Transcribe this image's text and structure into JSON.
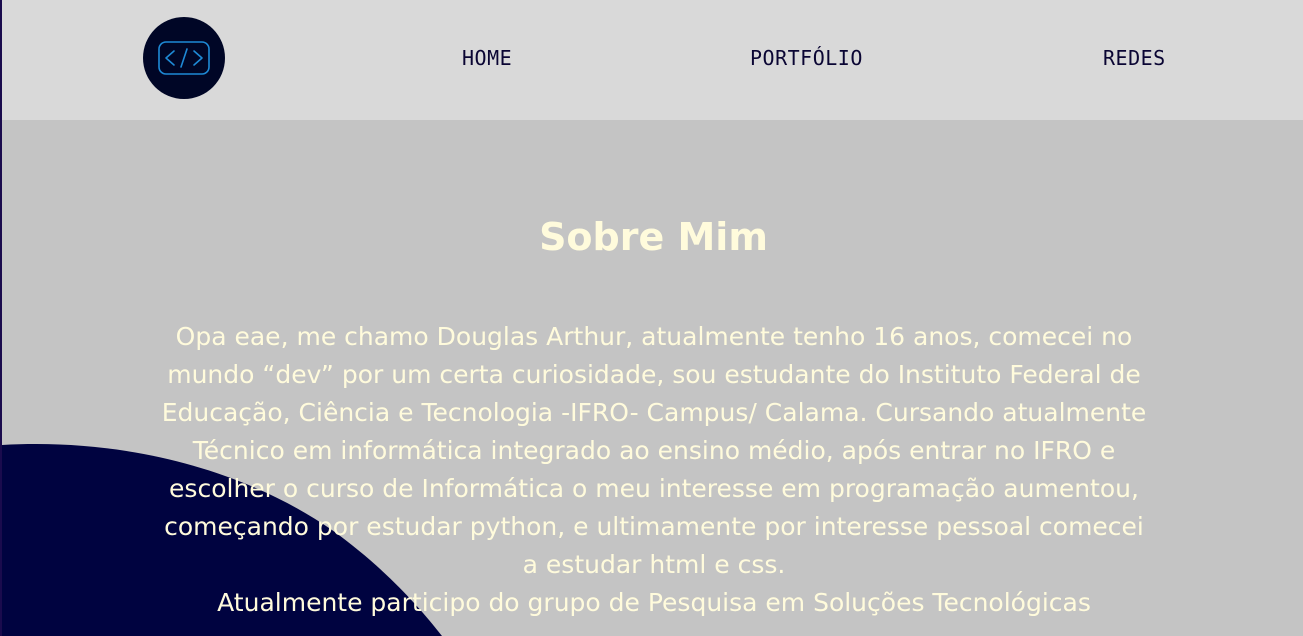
{
  "navbar": {
    "logo_icon": "code-brackets-icon",
    "links": [
      {
        "label": "HOME"
      },
      {
        "label": "PORTFÓLIO"
      },
      {
        "label": "REDES"
      }
    ]
  },
  "about": {
    "title": "Sobre Mim",
    "paragraph": "Opa eae, me chamo Douglas Arthur, atualmente tenho 16 anos, comecei no mundo “dev” por um certa curiosidade, sou estudante do Instituto Federal de Educação, Ciência e Tecnologia -IFRO- Campus/ Calama. Cursando atualmente Técnico em informática integrado ao ensino médio, após entrar no IFRO e escolher o curso de Informática o meu interesse em programação aumentou, começando por estudar python, e ultimamente por interesse pessoal comecei a estudar html e css.",
    "paragraph_next": "Atualmente participo do grupo de Pesquisa em Soluções Tecnológicas"
  },
  "colors": {
    "navbar_bg": "#d9d9d9",
    "page_bg": "#c4c4c4",
    "accent_dark": "#000340",
    "logo_bg": "#000626",
    "logo_glyph": "#1e8ad6",
    "nav_text": "#0a0533",
    "about_text": "#fffbdc"
  }
}
